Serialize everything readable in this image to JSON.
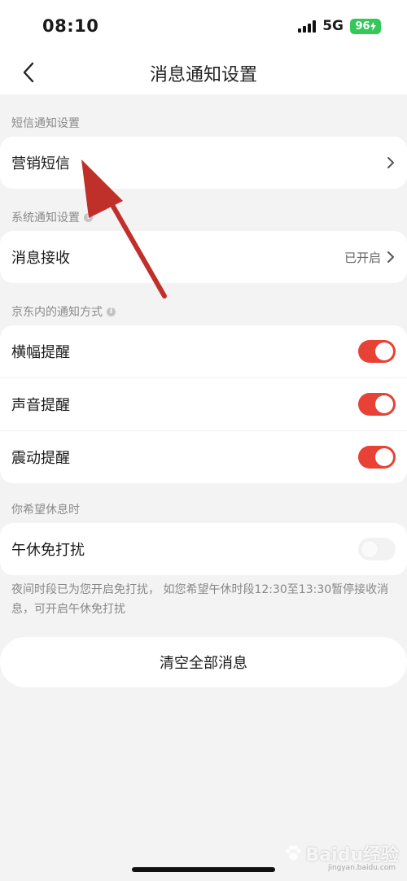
{
  "status_bar": {
    "time": "08:10",
    "network": "5G",
    "battery": "96"
  },
  "nav": {
    "title": "消息通知设置"
  },
  "sections": {
    "sms": {
      "label": "短信通知设置",
      "marketing_sms": "营销短信"
    },
    "system": {
      "label": "系统通知设置",
      "receive_label": "消息接收",
      "receive_value": "已开启"
    },
    "jd_methods": {
      "label": "京东内的通知方式",
      "banner": {
        "label": "横幅提醒",
        "on": true
      },
      "sound": {
        "label": "声音提醒",
        "on": true
      },
      "vibrate": {
        "label": "震动提醒",
        "on": true
      }
    },
    "rest": {
      "label": "你希望休息时",
      "nap": {
        "label": "午休免打扰",
        "on": false
      },
      "note": "夜间时段已为您开启免打扰， 如您希望午休时段12:30至13:30暂停接收消息，可开启午休免打扰"
    }
  },
  "actions": {
    "clear_all": "清空全部消息"
  },
  "watermark": {
    "brand": "Baidu经验",
    "url": "jingyan.baidu.com"
  },
  "colors": {
    "accent": "#e84135",
    "battery": "#34c759",
    "annotation_arrow": "#c0302a"
  },
  "icons": {
    "back": "chevron-left-icon",
    "row_arrow": "chevron-right-icon",
    "info": "info-icon"
  }
}
